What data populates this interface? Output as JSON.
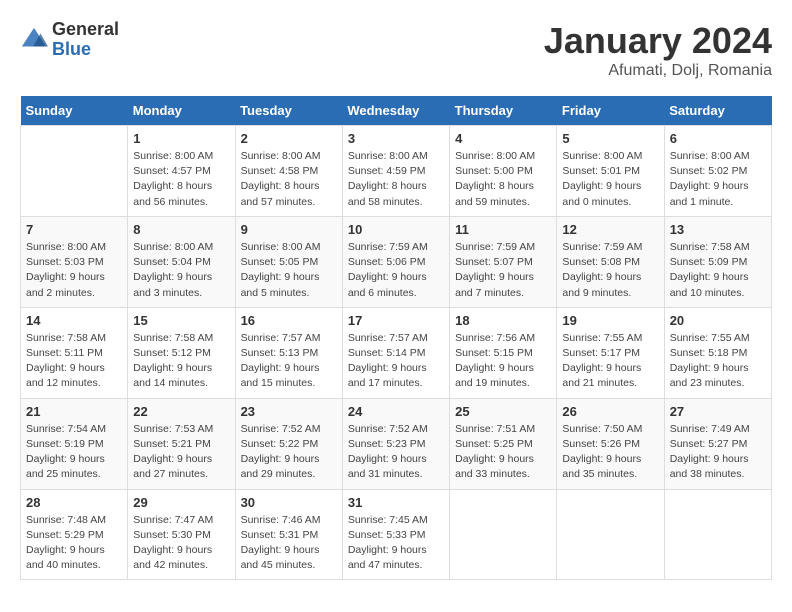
{
  "header": {
    "logo_general": "General",
    "logo_blue": "Blue",
    "month": "January 2024",
    "location": "Afumati, Dolj, Romania"
  },
  "weekdays": [
    "Sunday",
    "Monday",
    "Tuesday",
    "Wednesday",
    "Thursday",
    "Friday",
    "Saturday"
  ],
  "weeks": [
    [
      {
        "day": "",
        "info": ""
      },
      {
        "day": "1",
        "info": "Sunrise: 8:00 AM\nSunset: 4:57 PM\nDaylight: 8 hours\nand 56 minutes."
      },
      {
        "day": "2",
        "info": "Sunrise: 8:00 AM\nSunset: 4:58 PM\nDaylight: 8 hours\nand 57 minutes."
      },
      {
        "day": "3",
        "info": "Sunrise: 8:00 AM\nSunset: 4:59 PM\nDaylight: 8 hours\nand 58 minutes."
      },
      {
        "day": "4",
        "info": "Sunrise: 8:00 AM\nSunset: 5:00 PM\nDaylight: 8 hours\nand 59 minutes."
      },
      {
        "day": "5",
        "info": "Sunrise: 8:00 AM\nSunset: 5:01 PM\nDaylight: 9 hours\nand 0 minutes."
      },
      {
        "day": "6",
        "info": "Sunrise: 8:00 AM\nSunset: 5:02 PM\nDaylight: 9 hours\nand 1 minute."
      }
    ],
    [
      {
        "day": "7",
        "info": "Sunrise: 8:00 AM\nSunset: 5:03 PM\nDaylight: 9 hours\nand 2 minutes."
      },
      {
        "day": "8",
        "info": "Sunrise: 8:00 AM\nSunset: 5:04 PM\nDaylight: 9 hours\nand 3 minutes."
      },
      {
        "day": "9",
        "info": "Sunrise: 8:00 AM\nSunset: 5:05 PM\nDaylight: 9 hours\nand 5 minutes."
      },
      {
        "day": "10",
        "info": "Sunrise: 7:59 AM\nSunset: 5:06 PM\nDaylight: 9 hours\nand 6 minutes."
      },
      {
        "day": "11",
        "info": "Sunrise: 7:59 AM\nSunset: 5:07 PM\nDaylight: 9 hours\nand 7 minutes."
      },
      {
        "day": "12",
        "info": "Sunrise: 7:59 AM\nSunset: 5:08 PM\nDaylight: 9 hours\nand 9 minutes."
      },
      {
        "day": "13",
        "info": "Sunrise: 7:58 AM\nSunset: 5:09 PM\nDaylight: 9 hours\nand 10 minutes."
      }
    ],
    [
      {
        "day": "14",
        "info": "Sunrise: 7:58 AM\nSunset: 5:11 PM\nDaylight: 9 hours\nand 12 minutes."
      },
      {
        "day": "15",
        "info": "Sunrise: 7:58 AM\nSunset: 5:12 PM\nDaylight: 9 hours\nand 14 minutes."
      },
      {
        "day": "16",
        "info": "Sunrise: 7:57 AM\nSunset: 5:13 PM\nDaylight: 9 hours\nand 15 minutes."
      },
      {
        "day": "17",
        "info": "Sunrise: 7:57 AM\nSunset: 5:14 PM\nDaylight: 9 hours\nand 17 minutes."
      },
      {
        "day": "18",
        "info": "Sunrise: 7:56 AM\nSunset: 5:15 PM\nDaylight: 9 hours\nand 19 minutes."
      },
      {
        "day": "19",
        "info": "Sunrise: 7:55 AM\nSunset: 5:17 PM\nDaylight: 9 hours\nand 21 minutes."
      },
      {
        "day": "20",
        "info": "Sunrise: 7:55 AM\nSunset: 5:18 PM\nDaylight: 9 hours\nand 23 minutes."
      }
    ],
    [
      {
        "day": "21",
        "info": "Sunrise: 7:54 AM\nSunset: 5:19 PM\nDaylight: 9 hours\nand 25 minutes."
      },
      {
        "day": "22",
        "info": "Sunrise: 7:53 AM\nSunset: 5:21 PM\nDaylight: 9 hours\nand 27 minutes."
      },
      {
        "day": "23",
        "info": "Sunrise: 7:52 AM\nSunset: 5:22 PM\nDaylight: 9 hours\nand 29 minutes."
      },
      {
        "day": "24",
        "info": "Sunrise: 7:52 AM\nSunset: 5:23 PM\nDaylight: 9 hours\nand 31 minutes."
      },
      {
        "day": "25",
        "info": "Sunrise: 7:51 AM\nSunset: 5:25 PM\nDaylight: 9 hours\nand 33 minutes."
      },
      {
        "day": "26",
        "info": "Sunrise: 7:50 AM\nSunset: 5:26 PM\nDaylight: 9 hours\nand 35 minutes."
      },
      {
        "day": "27",
        "info": "Sunrise: 7:49 AM\nSunset: 5:27 PM\nDaylight: 9 hours\nand 38 minutes."
      }
    ],
    [
      {
        "day": "28",
        "info": "Sunrise: 7:48 AM\nSunset: 5:29 PM\nDaylight: 9 hours\nand 40 minutes."
      },
      {
        "day": "29",
        "info": "Sunrise: 7:47 AM\nSunset: 5:30 PM\nDaylight: 9 hours\nand 42 minutes."
      },
      {
        "day": "30",
        "info": "Sunrise: 7:46 AM\nSunset: 5:31 PM\nDaylight: 9 hours\nand 45 minutes."
      },
      {
        "day": "31",
        "info": "Sunrise: 7:45 AM\nSunset: 5:33 PM\nDaylight: 9 hours\nand 47 minutes."
      },
      {
        "day": "",
        "info": ""
      },
      {
        "day": "",
        "info": ""
      },
      {
        "day": "",
        "info": ""
      }
    ]
  ]
}
